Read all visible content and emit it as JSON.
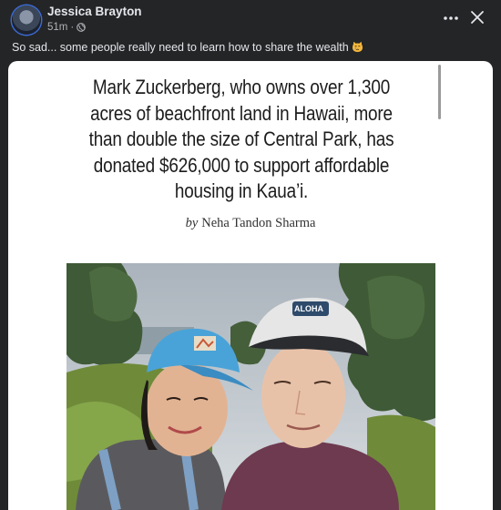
{
  "post": {
    "author": "Jessica Brayton",
    "time": "51m",
    "separator": "·",
    "caption": "So sad... some people really need to learn how to share the wealth",
    "caption_emoji": "crying-cat-face"
  },
  "icons": {
    "privacy": "globe-icon",
    "more": "more-options-icon",
    "close": "close-icon"
  },
  "article": {
    "headline_lines": [
      "Mark Zuckerberg, who owns over 1,300",
      "acres of beachfront land in Hawaii, more",
      "than double the size of Central Park, has",
      "donated $626,000 to support affordable",
      "housing in Kaua’i."
    ],
    "byline_prefix": "by",
    "byline_author": "Neha Tandon Sharma",
    "hat_text": "ALOHA"
  },
  "colors": {
    "background": "#242526",
    "card": "#ffffff",
    "avatar_ring": "#3a6bd4",
    "left_cap": "#4aa3d8",
    "right_cap": "#2a2c30",
    "right_shirt": "#6e3a4f"
  }
}
